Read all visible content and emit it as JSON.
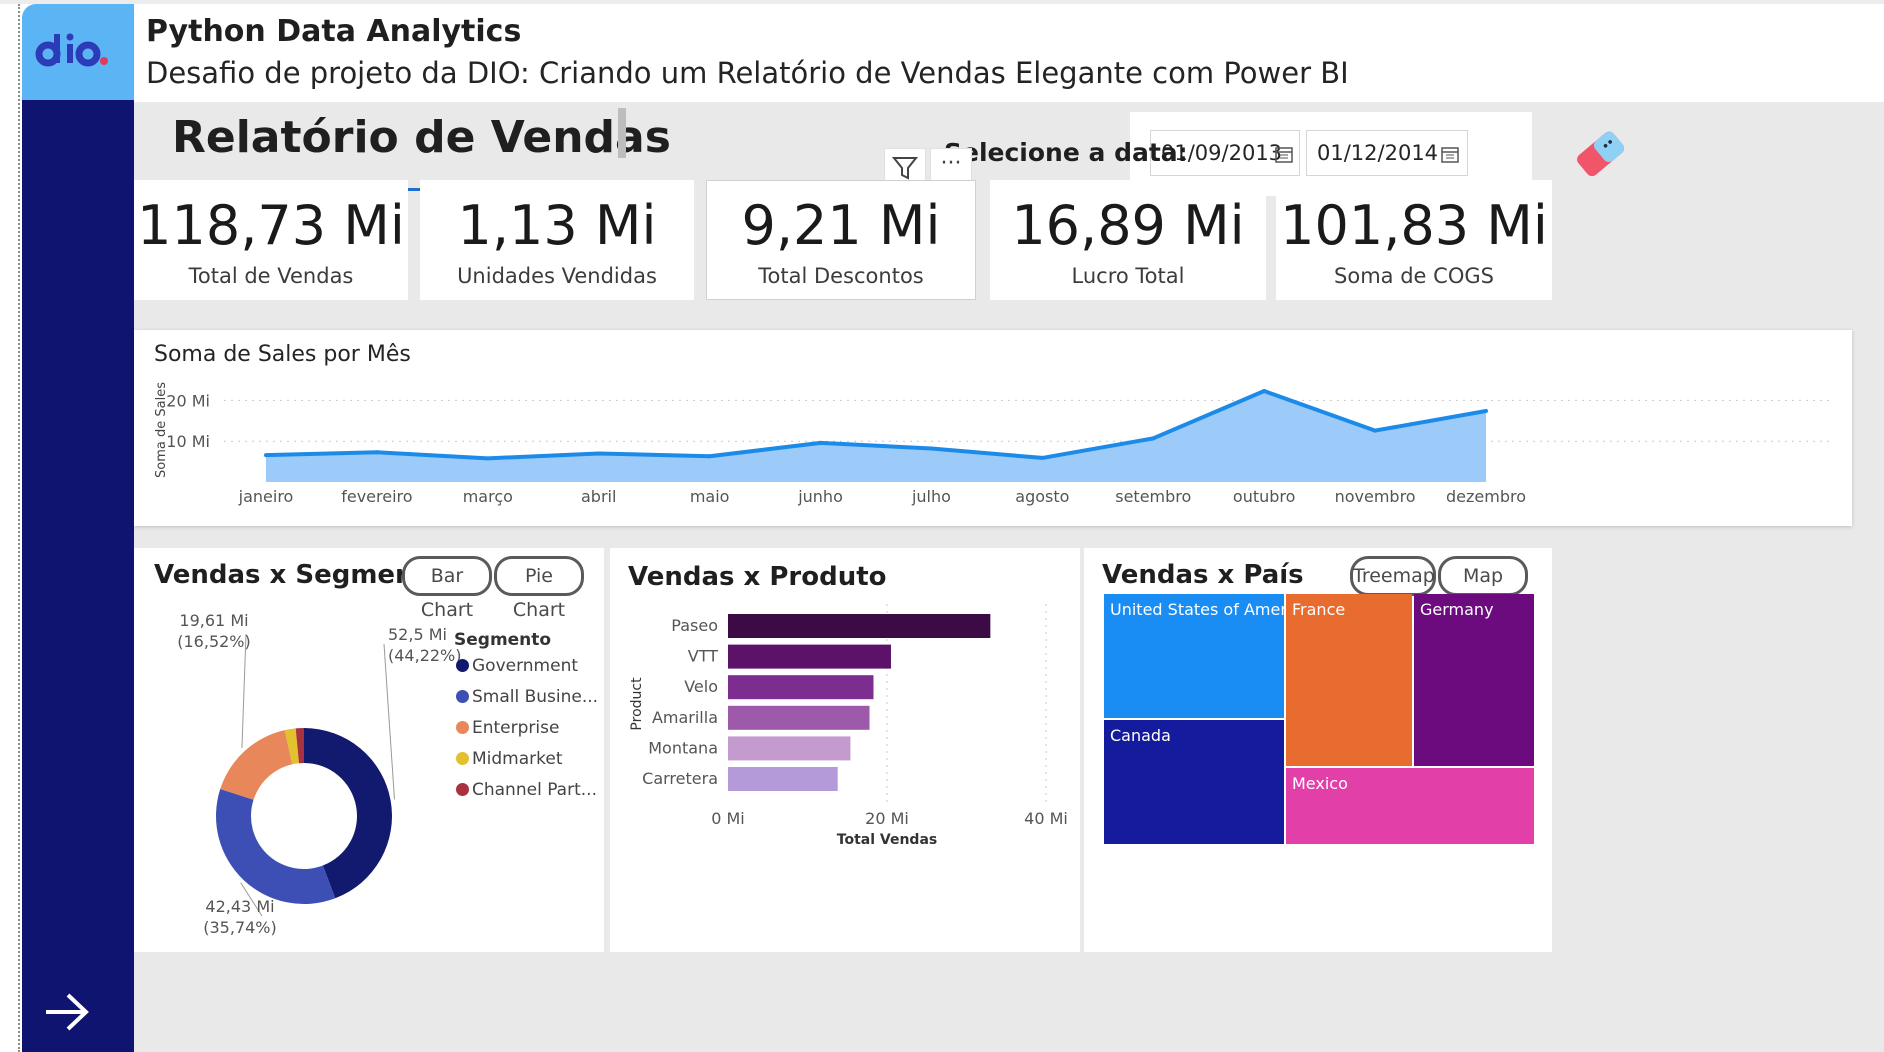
{
  "header": {
    "title": "Python Data Analytics",
    "subtitle": "Desafio de projeto da DIO: Criando um Relatório de Vendas Elegante com Power BI"
  },
  "report": {
    "title": "Relatório de Vendas",
    "date_label": "Selecione a data:",
    "date_start": "01/09/2013",
    "date_end": "01/12/2014"
  },
  "kpis": [
    {
      "value": "118,73 Mi",
      "label": "Total de Vendas"
    },
    {
      "value": "1,13 Mi",
      "label": "Unidades Vendidas"
    },
    {
      "value": "9,21 Mi",
      "label": "Total Descontos"
    },
    {
      "value": "16,89 Mi",
      "label": "Lucro Total"
    },
    {
      "value": "101,83 Mi",
      "label": "Soma de COGS"
    }
  ],
  "visual_header": {
    "more_label": "···"
  },
  "colors": {
    "sidebar": "#0f1471",
    "logo_bg": "#5bb4f4",
    "accent_line": "#1f6fd1",
    "area_fill": "#9dcbf9",
    "area_line": "#1c8ae8"
  },
  "icons": {
    "filter": "filter-icon",
    "more": "more-options-icon",
    "calendar": "calendar-icon",
    "eraser": "eraser-icon",
    "arrow": "arrow-right-icon",
    "logo": "dio-logo"
  },
  "chart_data": [
    {
      "type": "area",
      "title": "Soma de Sales por Mês",
      "ylabel": "Soma de Sales",
      "xlabel": "",
      "categories": [
        "janeiro",
        "fevereiro",
        "março",
        "abril",
        "maio",
        "junho",
        "julho",
        "agosto",
        "setembro",
        "outubro",
        "novembro",
        "dezembro"
      ],
      "values": [
        6.6,
        7.3,
        5.8,
        7.0,
        6.3,
        9.6,
        8.2,
        5.9,
        10.7,
        22.3,
        12.6,
        17.4
      ],
      "yticks": [
        "10 Mi",
        "20 Mi"
      ],
      "ylim": [
        0,
        25
      ],
      "grid": true
    },
    {
      "type": "pie",
      "title": "Vendas x Segmento",
      "buttons": [
        "Bar Chart",
        "Pie Chart"
      ],
      "legend_title": "Segmento",
      "slices": [
        {
          "name": "Government",
          "legend": "Government",
          "value": 52.5,
          "pct": 44.22,
          "label": "52,5 Mi",
          "pct_label": "(44,22%)",
          "color": "#121a6f"
        },
        {
          "name": "Small Business",
          "legend": "Small Busine...",
          "value": 42.43,
          "pct": 35.74,
          "label": "42,43 Mi",
          "pct_label": "(35,74%)",
          "color": "#3d4fb5"
        },
        {
          "name": "Enterprise",
          "legend": "Enterprise",
          "value": 19.61,
          "pct": 16.52,
          "label": "19,61 Mi",
          "pct_label": "(16,52%)",
          "color": "#e8875a"
        },
        {
          "name": "Midmarket",
          "legend": "Midmarket",
          "value": 2.4,
          "pct": 2.02,
          "label": "",
          "pct_label": "",
          "color": "#e3c12e"
        },
        {
          "name": "Channel Partners",
          "legend": "Channel Part...",
          "value": 1.79,
          "pct": 1.5,
          "label": "",
          "pct_label": "",
          "color": "#a83240"
        }
      ],
      "legend_position": "right"
    },
    {
      "type": "bar",
      "orientation": "horizontal",
      "title": "Vendas x Produto",
      "categories": [
        "Paseo",
        "VTT",
        "Velo",
        "Amarilla",
        "Montana",
        "Carretera"
      ],
      "values": [
        33.0,
        20.5,
        18.3,
        17.8,
        15.4,
        13.8
      ],
      "colors": [
        "#3c0a45",
        "#5b1268",
        "#7d2c8f",
        "#9d5aab",
        "#c59bcf",
        "#b59ad9"
      ],
      "xlabel": "Total Vendas",
      "ylabel": "Product",
      "xticks": [
        "0 Mi",
        "20 Mi",
        "40 Mi"
      ],
      "xlim": [
        0,
        40
      ]
    },
    {
      "type": "treemap",
      "title": "Vendas x País",
      "buttons": [
        "Treemap",
        "Map Chart"
      ],
      "items": [
        {
          "name": "United States of Amer...",
          "color": "#1a8df5"
        },
        {
          "name": "Canada",
          "color": "#141b9c"
        },
        {
          "name": "France",
          "color": "#e86b2f"
        },
        {
          "name": "Germany",
          "color": "#6b0b7e"
        },
        {
          "name": "Mexico",
          "color": "#e33fa9"
        }
      ]
    }
  ]
}
